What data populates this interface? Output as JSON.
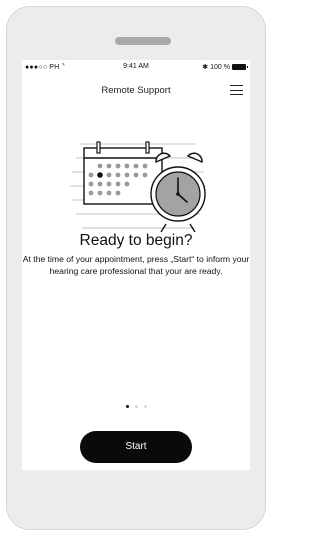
{
  "status_bar": {
    "carrier": "●●●○○ PH",
    "time": "9:41 AM",
    "battery": "100 %"
  },
  "header": {
    "title": "Remote Support",
    "menu_icon": "hamburger-icon"
  },
  "content": {
    "illustration_icon": "calendar-alarm-clock-icon",
    "headline": "Ready to begin?",
    "body": "At the time of your appointment, press „Start“ to inform your hearing care professional that your are ready."
  },
  "pager": {
    "count": 3,
    "active_index": 0
  },
  "actions": {
    "start_label": "Start"
  }
}
